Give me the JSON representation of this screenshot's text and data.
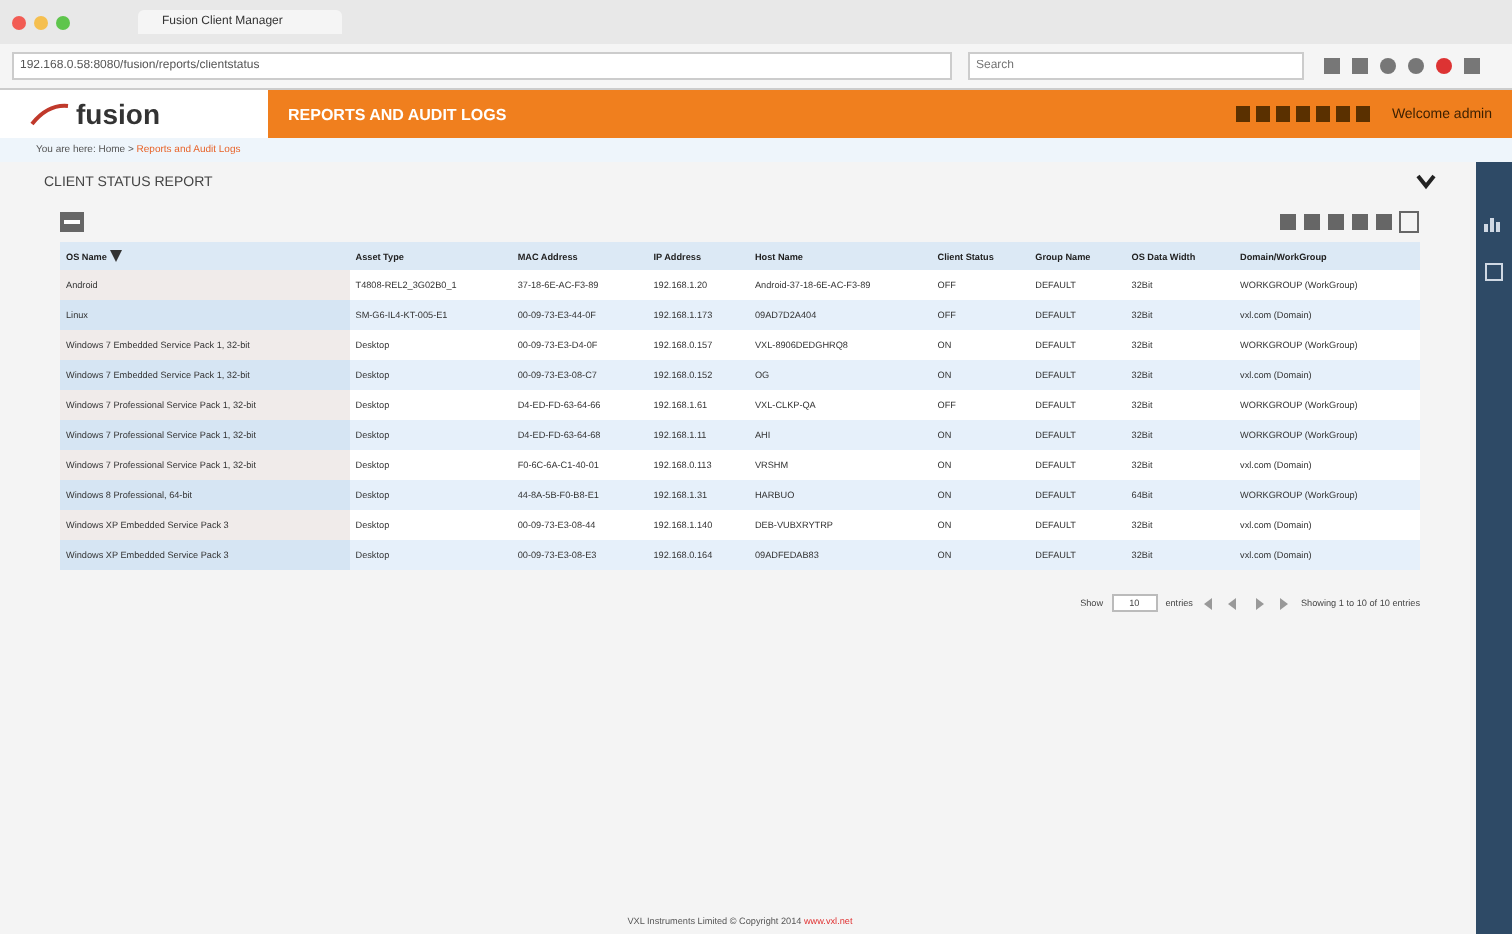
{
  "browser": {
    "tab_title": "Fusion Client Manager",
    "url": "192.168.0.58:8080/fusion/reports/clientstatus",
    "search_placeholder": "Search"
  },
  "header": {
    "logo": "fusion",
    "title": "REPORTS AND AUDIT LOGS",
    "user": "Welcome admin"
  },
  "breadcrumb": {
    "prefix": "You are here: Home >",
    "current": "Reports and Audit Logs"
  },
  "section": {
    "title": "CLIENT STATUS REPORT"
  },
  "table": {
    "columns": [
      {
        "label": "OS Name",
        "sorted": true
      },
      {
        "label": "Asset Type",
        "sorted": false
      },
      {
        "label": "MAC Address",
        "sorted": false
      },
      {
        "label": "IP Address",
        "sorted": false
      },
      {
        "label": "Host Name",
        "sorted": false
      },
      {
        "label": "Client Status",
        "sorted": false
      },
      {
        "label": "Group Name",
        "sorted": false
      },
      {
        "label": "OS Data Width",
        "sorted": false
      },
      {
        "label": "Domain/WorkGroup",
        "sorted": false
      }
    ],
    "rows": [
      [
        "Android",
        "T4808-REL2_3G02B0_1",
        "37-18-6E-AC-F3-89",
        "192.168.1.20",
        "Android-37-18-6E-AC-F3-89",
        "OFF",
        "DEFAULT",
        "32Bit",
        "WORKGROUP (WorkGroup)"
      ],
      [
        "Linux",
        "SM-G6-IL4-KT-005-E1",
        "00-09-73-E3-44-0F",
        "192.168.1.173",
        "09AD7D2A404",
        "OFF",
        "DEFAULT",
        "32Bit",
        "vxl.com (Domain)"
      ],
      [
        "Windows 7 Embedded Service Pack 1, 32-bit",
        "Desktop",
        "00-09-73-E3-D4-0F",
        "192.168.0.157",
        "VXL-8906DEDGHRQ8",
        "ON",
        "DEFAULT",
        "32Bit",
        "WORKGROUP (WorkGroup)"
      ],
      [
        "Windows 7 Embedded Service Pack 1, 32-bit",
        "Desktop",
        "00-09-73-E3-08-C7",
        "192.168.0.152",
        "OG",
        "ON",
        "DEFAULT",
        "32Bit",
        "vxl.com (Domain)"
      ],
      [
        "Windows 7 Professional Service Pack 1, 32-bit",
        "Desktop",
        "D4-ED-FD-63-64-66",
        "192.168.1.61",
        "VXL-CLKP-QA",
        "OFF",
        "DEFAULT",
        "32Bit",
        "WORKGROUP (WorkGroup)"
      ],
      [
        "Windows 7 Professional Service Pack 1, 32-bit",
        "Desktop",
        "D4-ED-FD-63-64-68",
        "192.168.1.11",
        "AHI",
        "ON",
        "DEFAULT",
        "32Bit",
        "WORKGROUP (WorkGroup)"
      ],
      [
        "Windows 7 Professional Service Pack 1, 32-bit",
        "Desktop",
        "F0-6C-6A-C1-40-01",
        "192.168.0.113",
        "VRSHM",
        "ON",
        "DEFAULT",
        "32Bit",
        "vxl.com (Domain)"
      ],
      [
        "Windows 8 Professional, 64-bit",
        "Desktop",
        "44-8A-5B-F0-B8-E1",
        "192.168.1.31",
        "HARBUO",
        "ON",
        "DEFAULT",
        "64Bit",
        "WORKGROUP (WorkGroup)"
      ],
      [
        "Windows XP Embedded Service Pack 3",
        "Desktop",
        "00-09-73-E3-08-44",
        "192.168.1.140",
        "DEB-VUBXRYTRP",
        "ON",
        "DEFAULT",
        "32Bit",
        "vxl.com (Domain)"
      ],
      [
        "Windows XP Embedded Service Pack 3",
        "Desktop",
        "00-09-73-E3-08-E3",
        "192.168.0.164",
        "09ADFEDAB83",
        "ON",
        "DEFAULT",
        "32Bit",
        "vxl.com (Domain)"
      ]
    ]
  },
  "pager": {
    "show_label": "Show",
    "page_size": "10",
    "entries_label": "entries",
    "summary": "Showing 1 to 10 of 10 entries"
  },
  "footer": {
    "text": "VXL Instruments Limited © Copyright 2014",
    "link": "www.vxl.net"
  }
}
